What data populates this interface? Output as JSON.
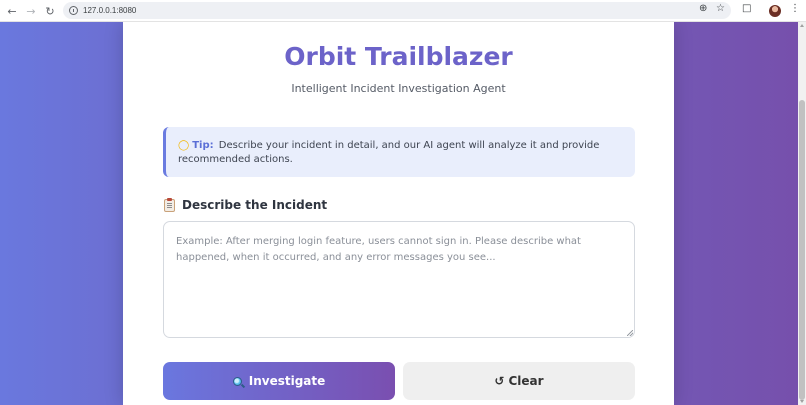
{
  "browser": {
    "url": "127.0.0.1:8080",
    "back_icon": "back-arrow-icon",
    "forward_icon": "forward-arrow-icon",
    "reload_icon": "reload-icon"
  },
  "header": {
    "title": "Orbit Trailblazer",
    "subtitle": "Intelligent Incident Investigation Agent"
  },
  "tip": {
    "label": "Tip:",
    "text": "Describe your incident in detail, and our AI agent will analyze it and provide recommended actions."
  },
  "incident": {
    "label": "Describe the Incident",
    "value": "",
    "placeholder": "Example: After merging login feature, users cannot sign in. Please describe what happened, when it occurred, and any error messages you see..."
  },
  "actions": {
    "investigate_label": "Investigate",
    "clear_label": "Clear"
  },
  "colors": {
    "accent": "#6c63c9",
    "gradient_start": "#6a77df",
    "gradient_end": "#7a4fb0",
    "tip_background": "#e9eefc",
    "tip_border": "#6a7be0"
  }
}
